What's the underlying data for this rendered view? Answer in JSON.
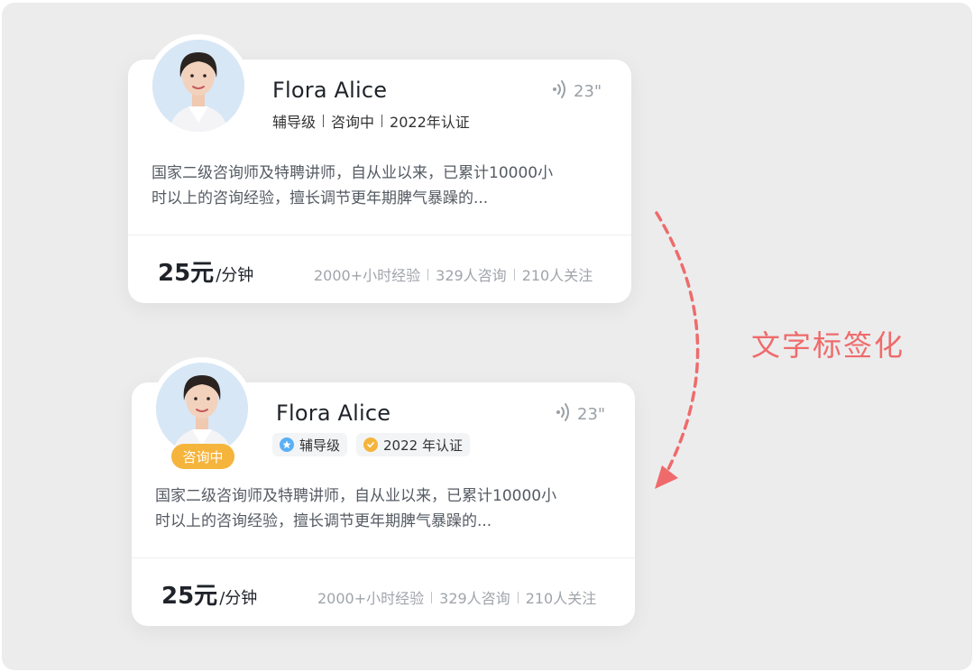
{
  "annotation": {
    "label": "文字标签化",
    "color": "#ef6b6b"
  },
  "card_before": {
    "name": "Flora Alice",
    "meta": [
      "辅导级",
      "咨询中",
      "2022年认证"
    ],
    "duration": "23\"",
    "description_line1": "国家二级咨询师及特聘讲师，自从业以来，已累计10000小",
    "description_line2": "时以上的咨询经验，擅长调节更年期脾气暴躁的...",
    "price_value": "25元",
    "price_unit": "/分钟",
    "stats": [
      "2000+小时经验",
      "329人咨询",
      "210人关注"
    ]
  },
  "card_after": {
    "name": "Flora Alice",
    "status_badge": "咨询中",
    "tags": [
      {
        "label": "辅导级",
        "icon": "star-badge-icon",
        "color": "#5ab0f5"
      },
      {
        "label": "2022 年认证",
        "icon": "check-badge-icon",
        "color": "#f5b43b"
      }
    ],
    "duration": "23\"",
    "description_line1": "国家二级咨询师及特聘讲师，自从业以来，已累计10000小",
    "description_line2": "时以上的咨询经验，擅长调节更年期脾气暴躁的...",
    "price_value": "25元",
    "price_unit": "/分钟",
    "stats": [
      "2000+小时经验",
      "329人咨询",
      "210人关注"
    ]
  }
}
